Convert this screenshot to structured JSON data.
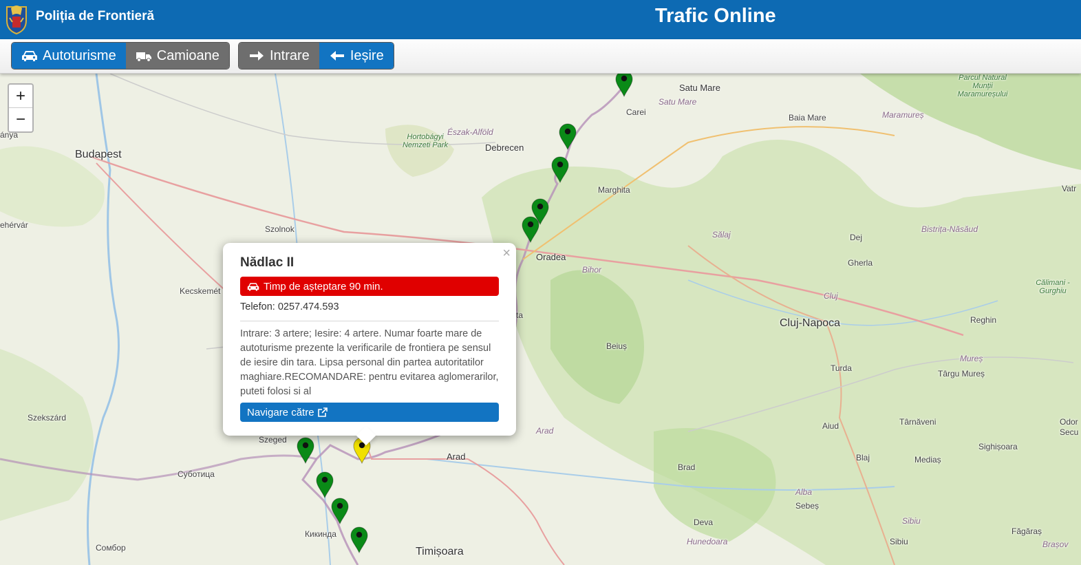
{
  "header": {
    "brand": "Poliția de Frontieră",
    "title": "Trafic Online"
  },
  "toolbar": {
    "vehicle_tabs": [
      {
        "label": "Autoturisme",
        "active": true
      },
      {
        "label": "Camioane",
        "active": false
      }
    ],
    "direction_tabs": [
      {
        "label": "Intrare",
        "active": false
      },
      {
        "label": "Ieșire",
        "active": true
      }
    ]
  },
  "zoom": {
    "in": "+",
    "out": "−"
  },
  "map_labels": {
    "satu_mare": "Satu Mare",
    "satu_mare_county": "Satu Mare",
    "carei": "Carei",
    "baia_mare": "Baia Mare",
    "maramures": "Maramureș",
    "natural_park": "Parcul Natural Munții Maramureșului",
    "budapest": "Budapest",
    "debrecen": "Debrecen",
    "eszak_alfold": "Észak-Alföld",
    "hortobagyi": "Hortobágyi Nemzeti Park",
    "marghita": "Marghita",
    "vatra": "Vatr",
    "szekesfehervar": "ehérvár",
    "szolnok": "Szolnok",
    "salaj": "Sălaj",
    "dej": "Dej",
    "bistrita": "Bistrița-Năsăud",
    "oradea": "Oradea",
    "bihor": "Bihor",
    "gherla": "Gherla",
    "calimani": "Călimani - Gurghiu",
    "kecskemet": "Kecskemét",
    "cluj": "Cluj",
    "cluj_napoca": "Cluj-Napoca",
    "reghin": "Reghin",
    "beius": "Beiuș",
    "turda": "Turda",
    "mures": "Mureș",
    "targu_mures": "Târgu Mureș",
    "szekszard": "Szekszárd",
    "szeged": "Szeged",
    "arad_region": "Arad",
    "aiud": "Aiud",
    "tarnaveni": "Târnăveni",
    "odorheiu": "Odor Secu",
    "sighisoara": "Sighișoara",
    "arad": "Arad",
    "subotica": "Суботица",
    "blaj": "Blaj",
    "medias": "Mediaș",
    "brad": "Brad",
    "alba": "Alba",
    "sebes": "Sebeș",
    "kikinda": "Кикинда",
    "deva": "Deva",
    "sibiu_region": "Sibiu",
    "fagaras": "Făgăraș",
    "sombor": "Сомбор",
    "timisoara": "Timișoara",
    "hunedoara": "Hunedoara",
    "sibiu": "Sibiu",
    "brasov": "Brașov",
    "ta": "ta",
    "lanya": "ánya"
  },
  "markers": [
    {
      "name": "marker-1",
      "status": "green"
    },
    {
      "name": "marker-2",
      "status": "green"
    },
    {
      "name": "marker-3",
      "status": "green"
    },
    {
      "name": "marker-4",
      "status": "green"
    },
    {
      "name": "marker-5",
      "status": "green"
    },
    {
      "name": "marker-6",
      "status": "green"
    },
    {
      "name": "marker-nadlac-ii",
      "status": "yellow"
    },
    {
      "name": "marker-8",
      "status": "green"
    },
    {
      "name": "marker-9",
      "status": "green"
    },
    {
      "name": "marker-10",
      "status": "green"
    }
  ],
  "colors": {
    "header": "#0d6ab3",
    "active": "#1274c2",
    "inactive": "#6e6e6e",
    "marker_ok": "#0a8a17",
    "marker_warn": "#f0e000",
    "wait_bar": "#e00000"
  },
  "popup": {
    "title": "Nădlac II",
    "close": "×",
    "wait": "Timp de așteptare 90 min.",
    "phone": "Telefon: 0257.474.593",
    "notes": "Intrare: 3 artere; Iesire: 4 artere. Numar foarte mare de autoturisme prezente la verificarile de frontiera pe sensul de iesire din tara. Lipsa personal din partea autoritatilor maghiare.RECOMANDARE: pentru evitarea aglomerarilor, puteti folosi si al",
    "nav": "Navigare către"
  }
}
